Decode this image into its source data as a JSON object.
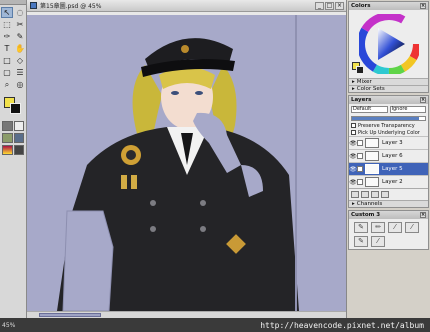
{
  "document": {
    "title": "第15章圖.psd @ 45%"
  },
  "toolbox": {
    "tools": [
      "↖",
      "◌",
      "⬚",
      "✂",
      "✑",
      "✎",
      "T",
      "✋",
      "□",
      "◇",
      "▢",
      "☰",
      "⌕",
      "◎"
    ],
    "fg_color": "#f2e24c",
    "bg_color": "#111111"
  },
  "panels": {
    "colors": {
      "title": "Colors"
    },
    "mixer": {
      "title": "Mixer"
    },
    "color_sets": {
      "title": "Color Sets"
    },
    "layers": {
      "title": "Layers",
      "composite_method": "Default",
      "mode": "Ignore",
      "opacity_percent": 92,
      "preserve_transparency_label": "Preserve Transparency",
      "pick_up_underlying_label": "Pick Up Underlying Color",
      "items": [
        {
          "name": "Layer 3",
          "active": false
        },
        {
          "name": "Layer 6",
          "active": false
        },
        {
          "name": "Layer 5",
          "active": true
        },
        {
          "name": "Layer 2",
          "active": false
        }
      ]
    },
    "channels": {
      "title": "Channels"
    },
    "custom": {
      "title": "Custom 3"
    }
  },
  "status": {
    "zoom": "45%",
    "url": "http://heavencode.pixnet.net/album"
  },
  "colors": {
    "canvas_bg": "#a7a9c9",
    "accent": "#3f63b8",
    "fg_swatch": "#f2e24c"
  }
}
